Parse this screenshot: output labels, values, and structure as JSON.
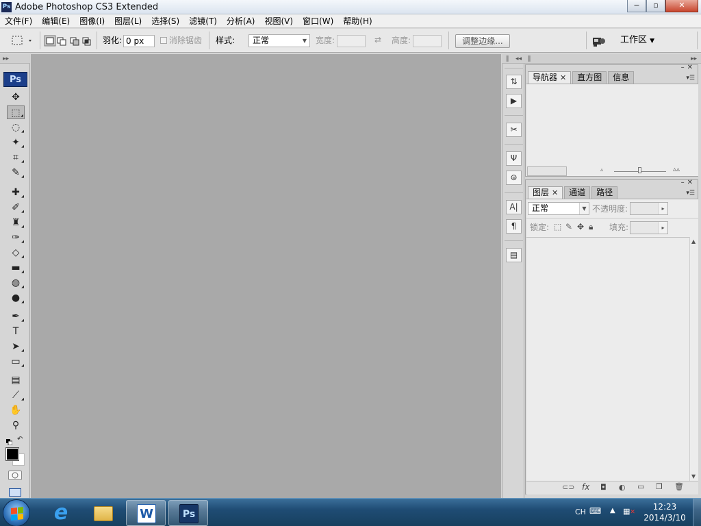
{
  "window": {
    "title": "Adobe Photoshop CS3 Extended",
    "app_icon_text": "Ps",
    "minimize": "−",
    "maximize": "▫",
    "close": "✕"
  },
  "menu": [
    "文件(F)",
    "编辑(E)",
    "图像(I)",
    "图层(L)",
    "选择(S)",
    "滤镜(T)",
    "分析(A)",
    "视图(V)",
    "窗口(W)",
    "帮助(H)"
  ],
  "options": {
    "feather_label": "羽化:",
    "feather_value": "0 px",
    "antialias_label": "消除锯齿",
    "style_label": "样式:",
    "style_value": "正常",
    "width_label": "宽度:",
    "height_label": "高度:",
    "refine_edge": "调整边缘...",
    "workspace": "工作区"
  },
  "toolbox": {
    "logo": "Ps",
    "tools": [
      {
        "name": "move-tool",
        "glyph": "✥"
      },
      {
        "name": "marquee-tool",
        "glyph": "⬚"
      },
      {
        "name": "lasso-tool",
        "glyph": "◌"
      },
      {
        "name": "magic-wand-tool",
        "glyph": "✦"
      },
      {
        "name": "crop-tool",
        "glyph": "⌗"
      },
      {
        "name": "slice-tool",
        "glyph": "✎"
      },
      {
        "name": "healing-brush-tool",
        "glyph": "✚"
      },
      {
        "name": "brush-tool",
        "glyph": "✐"
      },
      {
        "name": "clone-stamp-tool",
        "glyph": "♜"
      },
      {
        "name": "history-brush-tool",
        "glyph": "✑"
      },
      {
        "name": "eraser-tool",
        "glyph": "◇"
      },
      {
        "name": "gradient-tool",
        "glyph": "▬"
      },
      {
        "name": "blur-tool",
        "glyph": "◍"
      },
      {
        "name": "dodge-tool",
        "glyph": "●"
      },
      {
        "name": "pen-tool",
        "glyph": "✒"
      },
      {
        "name": "type-tool",
        "glyph": "T"
      },
      {
        "name": "path-selection-tool",
        "glyph": "➤"
      },
      {
        "name": "shape-tool",
        "glyph": "▭"
      },
      {
        "name": "notes-tool",
        "glyph": "▤"
      },
      {
        "name": "eyedropper-tool",
        "glyph": "⟋"
      },
      {
        "name": "hand-tool",
        "glyph": "✋"
      },
      {
        "name": "zoom-tool",
        "glyph": "⚲"
      }
    ]
  },
  "dock_icons": [
    {
      "name": "history-icon",
      "glyph": "⇅"
    },
    {
      "name": "actions-icon",
      "glyph": "▶"
    },
    {
      "name": "tool-presets-icon",
      "glyph": "✂"
    },
    {
      "name": "brushes-icon",
      "glyph": "Ψ"
    },
    {
      "name": "clone-source-icon",
      "glyph": "⊜"
    },
    {
      "name": "character-icon",
      "glyph": "A|"
    },
    {
      "name": "paragraph-icon",
      "glyph": "¶"
    },
    {
      "name": "layer-comps-icon",
      "glyph": "▤"
    }
  ],
  "navigator_panel": {
    "tabs": [
      "导航器",
      "直方图",
      "信息"
    ]
  },
  "layers_panel": {
    "tabs": [
      "图层",
      "通道",
      "路径"
    ],
    "blend_mode": "正常",
    "opacity_label": "不透明度:",
    "lock_label": "锁定:",
    "fill_label": "填充:"
  },
  "taskbar": {
    "lang": "CH",
    "time": "12:23",
    "date": "2014/3/10",
    "photoshop_label": "Ps",
    "word_label": "W"
  }
}
